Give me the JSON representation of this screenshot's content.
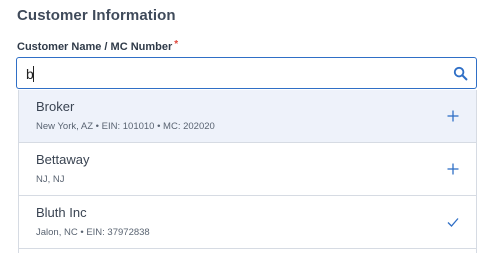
{
  "section": {
    "title": "Customer Information"
  },
  "field": {
    "label": "Customer Name / MC Number",
    "required_mark": "*",
    "value": "b"
  },
  "options": [
    {
      "name": "Broker",
      "details": "New York, AZ • EIN: 101010 • MC: 202020",
      "action_icon": "plus-icon",
      "selected": false
    },
    {
      "name": "Bettaway",
      "details": "NJ, NJ",
      "action_icon": "plus-icon",
      "selected": false
    },
    {
      "name": "Bluth Inc",
      "details": "Jalon, NC • EIN: 37972838",
      "action_icon": "check-icon",
      "selected": true
    }
  ],
  "colors": {
    "accent": "#2f6fc6",
    "active_row": "#eef2fa",
    "required": "#e0463b"
  }
}
